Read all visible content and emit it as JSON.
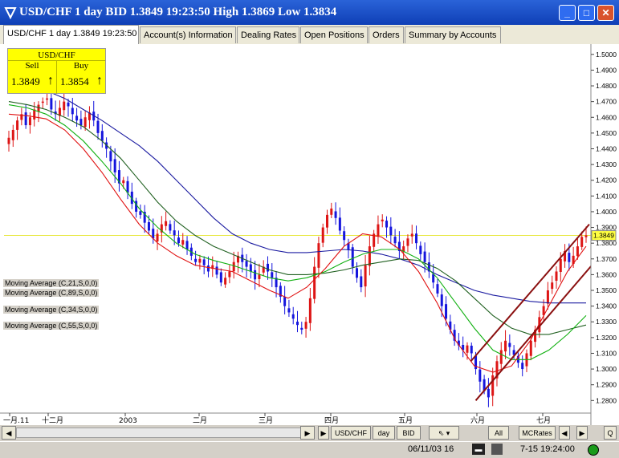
{
  "window": {
    "title": "USD/CHF 1 day BID 1.3849 19:23:50 High 1.3869 Low 1.3834",
    "min": "_",
    "max": "□",
    "close": "✕"
  },
  "tabs": [
    "USD/CHF 1 day 1.3849 19:23:50",
    "Account(s) Information",
    "Dealing Rates",
    "Open Positions",
    "Orders",
    "Summary by Accounts"
  ],
  "quote": {
    "pair": "USD/CHF",
    "sell_label": "Sell",
    "buy_label": "Buy",
    "sell": "1.3849",
    "buy": "1.3854",
    "arrow": "↑"
  },
  "legend": [
    "Moving Average (C,21,S,0,0)",
    "Moving Average (C,89,S,0,0)",
    "Moving Average (C,34,S,0,0)",
    "Moving Average (C,55,S,0,0)"
  ],
  "colors": {
    "up": "#dd1515",
    "down": "#1515dd",
    "ma21": "#e01010",
    "ma89": "#1a1aa0",
    "ma34": "#10b010",
    "ma55": "#206020",
    "last": "#e8e840"
  },
  "chart_data": {
    "type": "candlestick",
    "last_price": "1.3849",
    "x_ticks": [
      "一月.11",
      "十二月",
      "2003",
      "二月",
      "三月",
      "四月",
      "五月",
      "六月",
      "七月"
    ],
    "y_ticks": [
      "1.5000",
      "1.4900",
      "1.4800",
      "1.4700",
      "1.4600",
      "1.4500",
      "1.4400",
      "1.4300",
      "1.4200",
      "1.4100",
      "1.4000",
      "1.3900",
      "1.3800",
      "1.3700",
      "1.3600",
      "1.3500",
      "1.3400",
      "1.3300",
      "1.3200",
      "1.3100",
      "1.3000",
      "1.2900",
      "1.2800"
    ],
    "ylim": [
      1.272,
      1.505
    ],
    "closes": [
      1.447,
      1.452,
      1.458,
      1.462,
      1.455,
      1.46,
      1.465,
      1.468,
      1.47,
      1.472,
      1.465,
      1.462,
      1.466,
      1.47,
      1.467,
      1.462,
      1.458,
      1.455,
      1.46,
      1.463,
      1.458,
      1.45,
      1.445,
      1.44,
      1.432,
      1.425,
      1.418,
      1.42,
      1.412,
      1.405,
      1.4,
      1.398,
      1.393,
      1.388,
      1.383,
      1.386,
      1.392,
      1.394,
      1.388,
      1.385,
      1.38,
      1.382,
      1.376,
      1.372,
      1.368,
      1.37,
      1.366,
      1.362,
      1.366,
      1.36,
      1.355,
      1.358,
      1.362,
      1.368,
      1.372,
      1.368,
      1.365,
      1.362,
      1.357,
      1.36,
      1.365,
      1.362,
      1.358,
      1.352,
      1.346,
      1.34,
      1.336,
      1.332,
      1.328,
      1.325,
      1.33,
      1.345,
      1.365,
      1.38,
      1.39,
      1.398,
      1.402,
      1.396,
      1.388,
      1.382,
      1.376,
      1.365,
      1.358,
      1.352,
      1.366,
      1.378,
      1.386,
      1.392,
      1.395,
      1.39,
      1.385,
      1.38,
      1.375,
      1.378,
      1.383,
      1.386,
      1.38,
      1.373,
      1.368,
      1.362,
      1.355,
      1.348,
      1.34,
      1.332,
      1.325,
      1.318,
      1.315,
      1.312,
      1.315,
      1.31,
      1.3,
      1.292,
      1.286,
      1.282,
      1.296,
      1.305,
      1.312,
      1.318,
      1.314,
      1.309,
      1.304,
      1.3,
      1.31,
      1.318,
      1.325,
      1.333,
      1.34,
      1.35,
      1.355,
      1.362,
      1.37,
      1.375,
      1.368,
      1.372,
      1.378,
      1.384,
      1.385
    ],
    "ma21": [
      1.462,
      1.461,
      1.459,
      1.452,
      1.44,
      1.425,
      1.408,
      1.392,
      1.38,
      1.372,
      1.366,
      1.364,
      1.362,
      1.356,
      1.35,
      1.345,
      1.352,
      1.364,
      1.378,
      1.386,
      1.384,
      1.376,
      1.362,
      1.342,
      1.318,
      1.302,
      1.298,
      1.302,
      1.318,
      1.34,
      1.362,
      1.378
    ],
    "ma34": [
      1.468,
      1.466,
      1.462,
      1.455,
      1.445,
      1.432,
      1.418,
      1.402,
      1.39,
      1.38,
      1.373,
      1.369,
      1.366,
      1.362,
      1.358,
      1.356,
      1.358,
      1.362,
      1.368,
      1.373,
      1.376,
      1.376,
      1.37,
      1.358,
      1.342,
      1.326,
      1.312,
      1.306,
      1.306,
      1.312,
      1.322,
      1.334
    ],
    "ma55": [
      1.47,
      1.468,
      1.465,
      1.46,
      1.454,
      1.445,
      1.434,
      1.42,
      1.406,
      1.394,
      1.385,
      1.378,
      1.373,
      1.368,
      1.363,
      1.36,
      1.36,
      1.361,
      1.363,
      1.366,
      1.368,
      1.37,
      1.369,
      1.364,
      1.356,
      1.345,
      1.334,
      1.326,
      1.322,
      1.322,
      1.325,
      1.328
    ],
    "ma89": [
      1.48,
      1.479,
      1.477,
      1.472,
      1.465,
      1.458,
      1.45,
      1.442,
      1.432,
      1.42,
      1.408,
      1.396,
      1.386,
      1.38,
      1.376,
      1.374,
      1.374,
      1.375,
      1.376,
      1.375,
      1.373,
      1.37,
      1.366,
      1.36,
      1.355,
      1.35,
      1.347,
      1.345,
      1.343,
      1.342,
      1.342,
      1.342
    ]
  },
  "bottom": {
    "buttons": [
      "USD/CHF",
      "day",
      "BID",
      "All",
      "MCRates",
      "Q"
    ],
    "play": "▶",
    "scroll_left": "◀",
    "scroll_right": "▶"
  },
  "status": {
    "date_left": "06/11/03 16",
    "date_right": "7-15 19:24:00"
  }
}
